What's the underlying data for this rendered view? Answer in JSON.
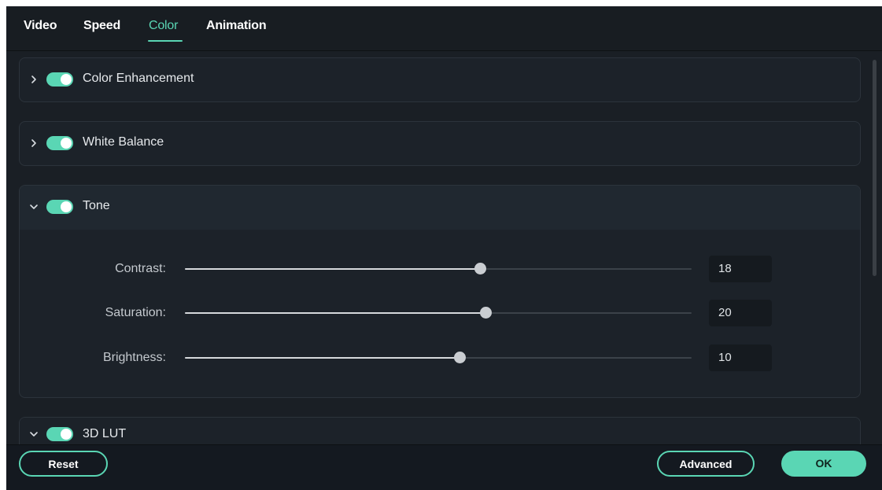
{
  "tabs": [
    {
      "label": "Video"
    },
    {
      "label": "Speed"
    },
    {
      "label": "Color"
    },
    {
      "label": "Animation"
    }
  ],
  "active_tab": "Color",
  "sections": [
    {
      "title": "Color Enhancement",
      "expanded": false,
      "enabled": true
    },
    {
      "title": "White Balance",
      "expanded": false,
      "enabled": true
    },
    {
      "title": "Tone",
      "expanded": true,
      "enabled": true
    },
    {
      "title": "3D LUT",
      "expanded": true,
      "enabled": true
    }
  ],
  "tone": {
    "contrast": {
      "label": "Contrast:",
      "value": "18",
      "slider_fraction": 0.583
    },
    "saturation": {
      "label": "Saturation:",
      "value": "20",
      "slider_fraction": 0.593
    },
    "brightness": {
      "label": "Brightness:",
      "value": "10",
      "slider_fraction": 0.542
    }
  },
  "footer": {
    "reset_label": "Reset",
    "advanced_label": "Advanced",
    "ok_label": "OK"
  },
  "colors": {
    "accent": "#5ad6b4",
    "background": "#1a1f25"
  },
  "icons": {
    "collapsed": "chevron-right-icon",
    "expanded": "chevron-down-icon"
  }
}
